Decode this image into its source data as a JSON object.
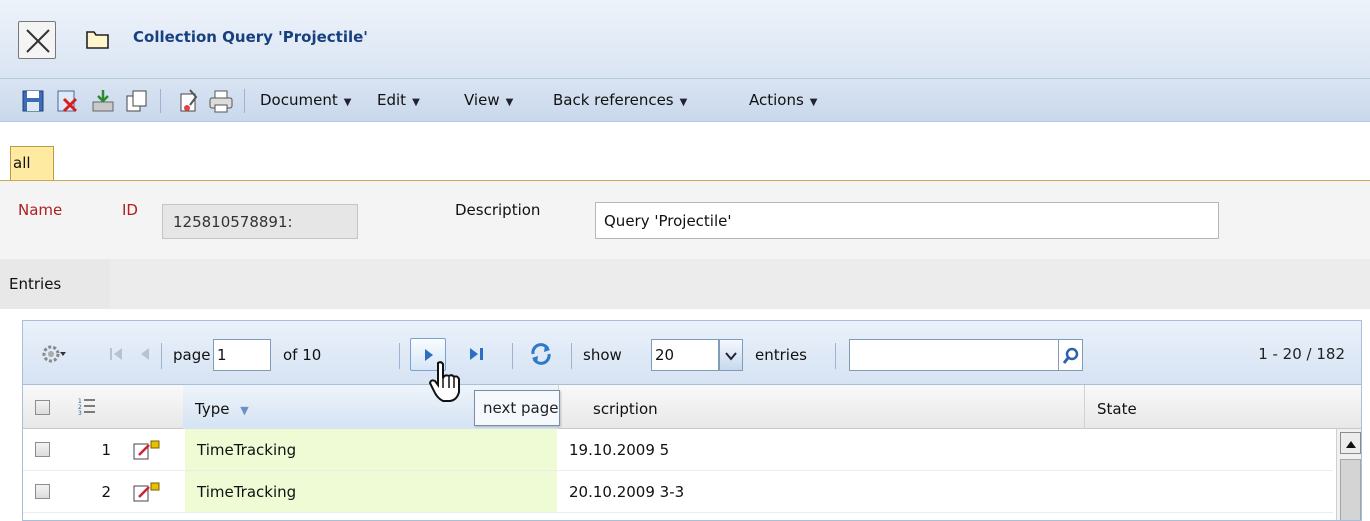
{
  "window": {
    "title": "Collection Query 'Projectile'"
  },
  "toolbar": {
    "icons": [
      "save-icon",
      "delete-icon",
      "export-icon",
      "copy-icon",
      "clip-icon",
      "print-icon"
    ],
    "menus": [
      {
        "label": "Document"
      },
      {
        "label": "Edit"
      },
      {
        "label": "View"
      },
      {
        "label": "Back references"
      },
      {
        "label": "Actions"
      }
    ]
  },
  "tabs": {
    "active": "all"
  },
  "form": {
    "name_label": "Name",
    "id_label": "ID",
    "id_value": "125810578891:",
    "description_label": "Description",
    "description_value": "Query 'Projectile'"
  },
  "section": {
    "entries_label": "Entries"
  },
  "pager": {
    "page_label": "page",
    "page_value": "1",
    "of_label": "of 10",
    "show_label": "show",
    "show_value": "20",
    "entries_label": "entries",
    "search_value": "",
    "count": "1 - 20 / 182"
  },
  "table": {
    "columns": [
      {
        "label": "Type",
        "sortable": true
      },
      {
        "label": "scription"
      },
      {
        "label": "State"
      }
    ],
    "rows": [
      {
        "num": "1",
        "type": "TimeTracking",
        "description": "19.10.2009 5",
        "state": ""
      },
      {
        "num": "2",
        "type": "TimeTracking",
        "description": "20.10.2009 3-3",
        "state": ""
      }
    ]
  },
  "tooltip": {
    "text": "next page"
  },
  "colors": {
    "title_text": "#16407e",
    "required_label": "#b02020",
    "tab_active": "#ffeaa2",
    "type_cell": "#eefbd5"
  }
}
